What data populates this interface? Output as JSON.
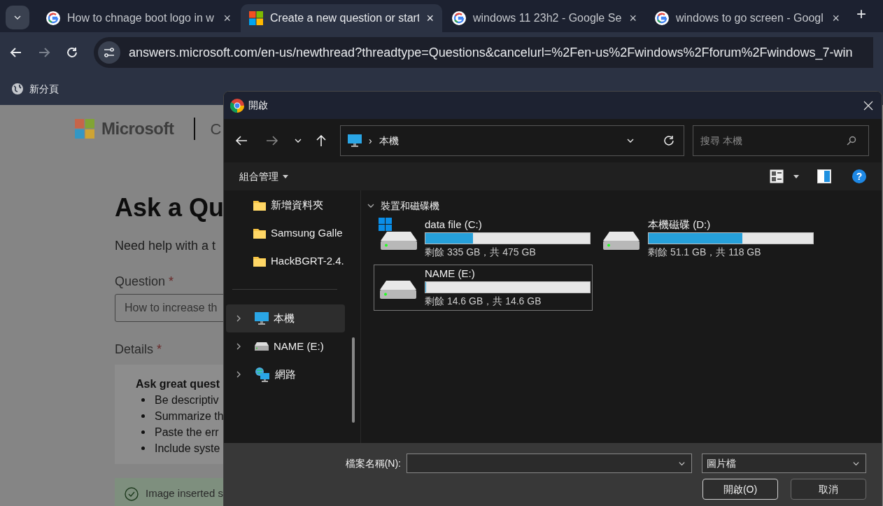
{
  "browser": {
    "tabs": [
      {
        "title": "How to chnage boot logo in w",
        "kind": "search",
        "close": "×",
        "selected": false
      },
      {
        "title": "Create a new question or start",
        "kind": "site",
        "close": "×",
        "selected": true
      },
      {
        "title": "windows 11 23h2 - Google Se",
        "kind": "search",
        "close": "×",
        "selected": false
      },
      {
        "title": "windows to go screen - Googl",
        "kind": "search",
        "close": "×",
        "selected": false
      }
    ],
    "new_tab": "+",
    "url": "answers.microsoft.com/en-us/newthread?threadtype=Questions&cancelurl=%2Fen-us%2Fwindows%2Fforum%2Fwindows_7-win",
    "bookmarks": [
      "新分頁"
    ]
  },
  "page": {
    "brand": "Microsoft",
    "brand_suffix": "C",
    "heading": "Ask a Qu",
    "intro": "Need help with a t",
    "question_label": "Question",
    "question_required": "*",
    "question_value": "How to increase th",
    "details_label": "Details",
    "details_required": "*",
    "tips_title": "Ask great quest",
    "tips": [
      "Be descriptiv",
      "Summarize th",
      "Paste the err",
      "Include syste"
    ],
    "notice": "Image inserted s"
  },
  "dialog": {
    "title": "開啟",
    "address_separator": "›",
    "address": "本機",
    "help": "?",
    "search_placeholder": "搜尋 本機",
    "organize": "組合管理",
    "quick_access": [
      {
        "label": "新增資料夾",
        "kind": "folder"
      },
      {
        "label": "Samsung Galle",
        "kind": "folder"
      },
      {
        "label": "HackBGRT-2.4.",
        "kind": "folder"
      }
    ],
    "tree": [
      {
        "label": "本機",
        "kind": "pc",
        "selected": true,
        "expanded": false
      },
      {
        "label": "NAME (E:)",
        "kind": "drive",
        "selected": false,
        "expanded": false
      },
      {
        "label": "網路",
        "kind": "network",
        "selected": false,
        "expanded": false
      }
    ],
    "group": {
      "label": "裝置和磁碟機",
      "expanded": true
    },
    "drives": [
      {
        "name": "data file (C:)",
        "kind": "system",
        "level": 0.29,
        "reading": "剩餘 335 GB，共 475 GB",
        "selected": false
      },
      {
        "name": "本機磁碟 (D:)",
        "kind": "drive",
        "level": 0.57,
        "reading": "剩餘 51.1 GB，共 118 GB",
        "selected": false
      },
      {
        "name": "NAME (E:)",
        "kind": "drive",
        "level": 0,
        "reading": "剩餘 14.6 GB，共 14.6 GB",
        "selected": true
      }
    ],
    "filename_label": "檔案名稱(N):",
    "file_type": "圖片檔",
    "buttons": [
      {
        "label": "開啟(O)",
        "primary": true
      },
      {
        "label": "取消",
        "primary": false
      }
    ]
  }
}
